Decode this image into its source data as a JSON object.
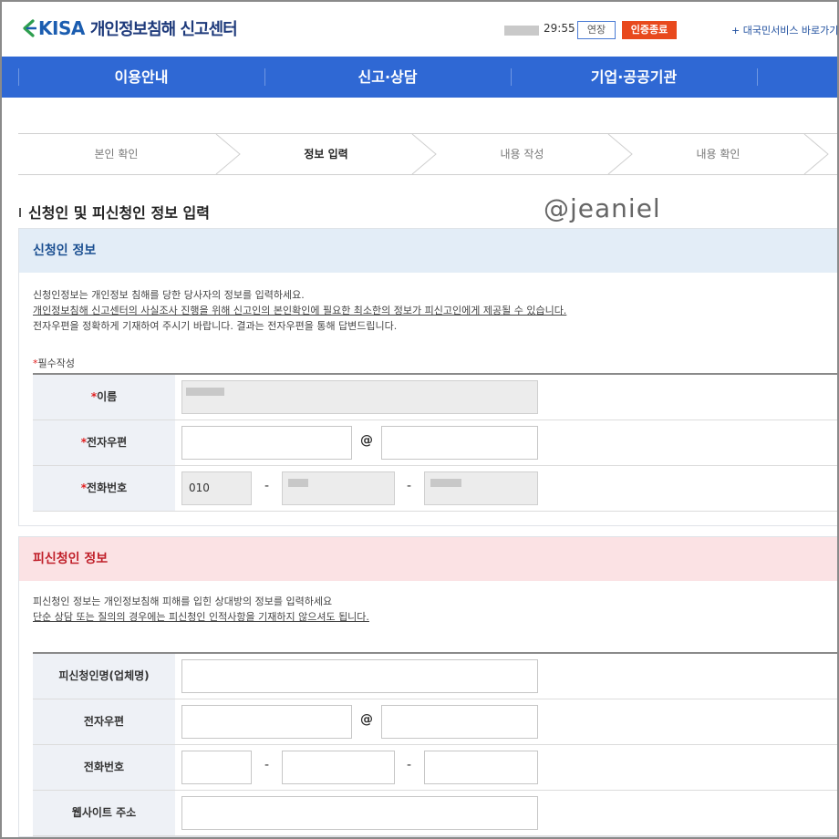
{
  "header": {
    "logo_kisa": "KISA",
    "logo_title": "개인정보침해 신고센터",
    "timer": "29:55",
    "extend_label": "연장",
    "logout_label": "인증종료",
    "gov_link": "+ 대국민서비스 바로가기"
  },
  "nav": {
    "items": [
      "이용안내",
      "신고·상담",
      "기업·공공기관"
    ]
  },
  "steps": [
    "본인 확인",
    "정보 입력",
    "내용 작성",
    "내용 확인"
  ],
  "active_step": "정보 입력",
  "section_title": "신청인 및 피신청인 정보 입력",
  "watermark": "@jeaniel",
  "applicant": {
    "heading": "신청인 정보",
    "desc_line1": "신청인정보는 개인정보 침해를 당한 당사자의 정보를 입력하세요.",
    "desc_line2": "개인정보침해 신고센터의 사실조사 진행을 위해 신고인의 본인확인에 필요한 최소한의 정보가 피신고인에게 제공될 수 있습니다.",
    "desc_line3": "전자우편을 정확하게 기재하여 주시기 바랍니다. 결과는 전자우편을 통해 답변드립니다.",
    "required_star": "*",
    "required_note": "필수작성",
    "name_label": "이름",
    "email_label": "전자우편",
    "phone_label": "전화번호",
    "phone_prefix": "010",
    "at_sign": "@",
    "dash": "-"
  },
  "respondent": {
    "heading": "피신청인 정보",
    "desc_line1": "피신청인 정보는 개인정보침해 피해를 입힌 상대방의 정보를 입력하세요",
    "desc_line2": "단순 상담 또는 질의의 경우에는 피신청인 인적사항을 기재하지 않으셔도 됩니다.",
    "name_label": "피신청인명(업체명)",
    "email_label": "전자우편",
    "phone_label": "전화번호",
    "website_label": "웹사이트 주소",
    "at_sign": "@",
    "dash": "-"
  },
  "colors": {
    "nav": "#2f68d4",
    "applicant_head_bg": "#e3edf7",
    "respondent_head_bg": "#fbe2e4",
    "logout_btn": "#e8491d"
  }
}
